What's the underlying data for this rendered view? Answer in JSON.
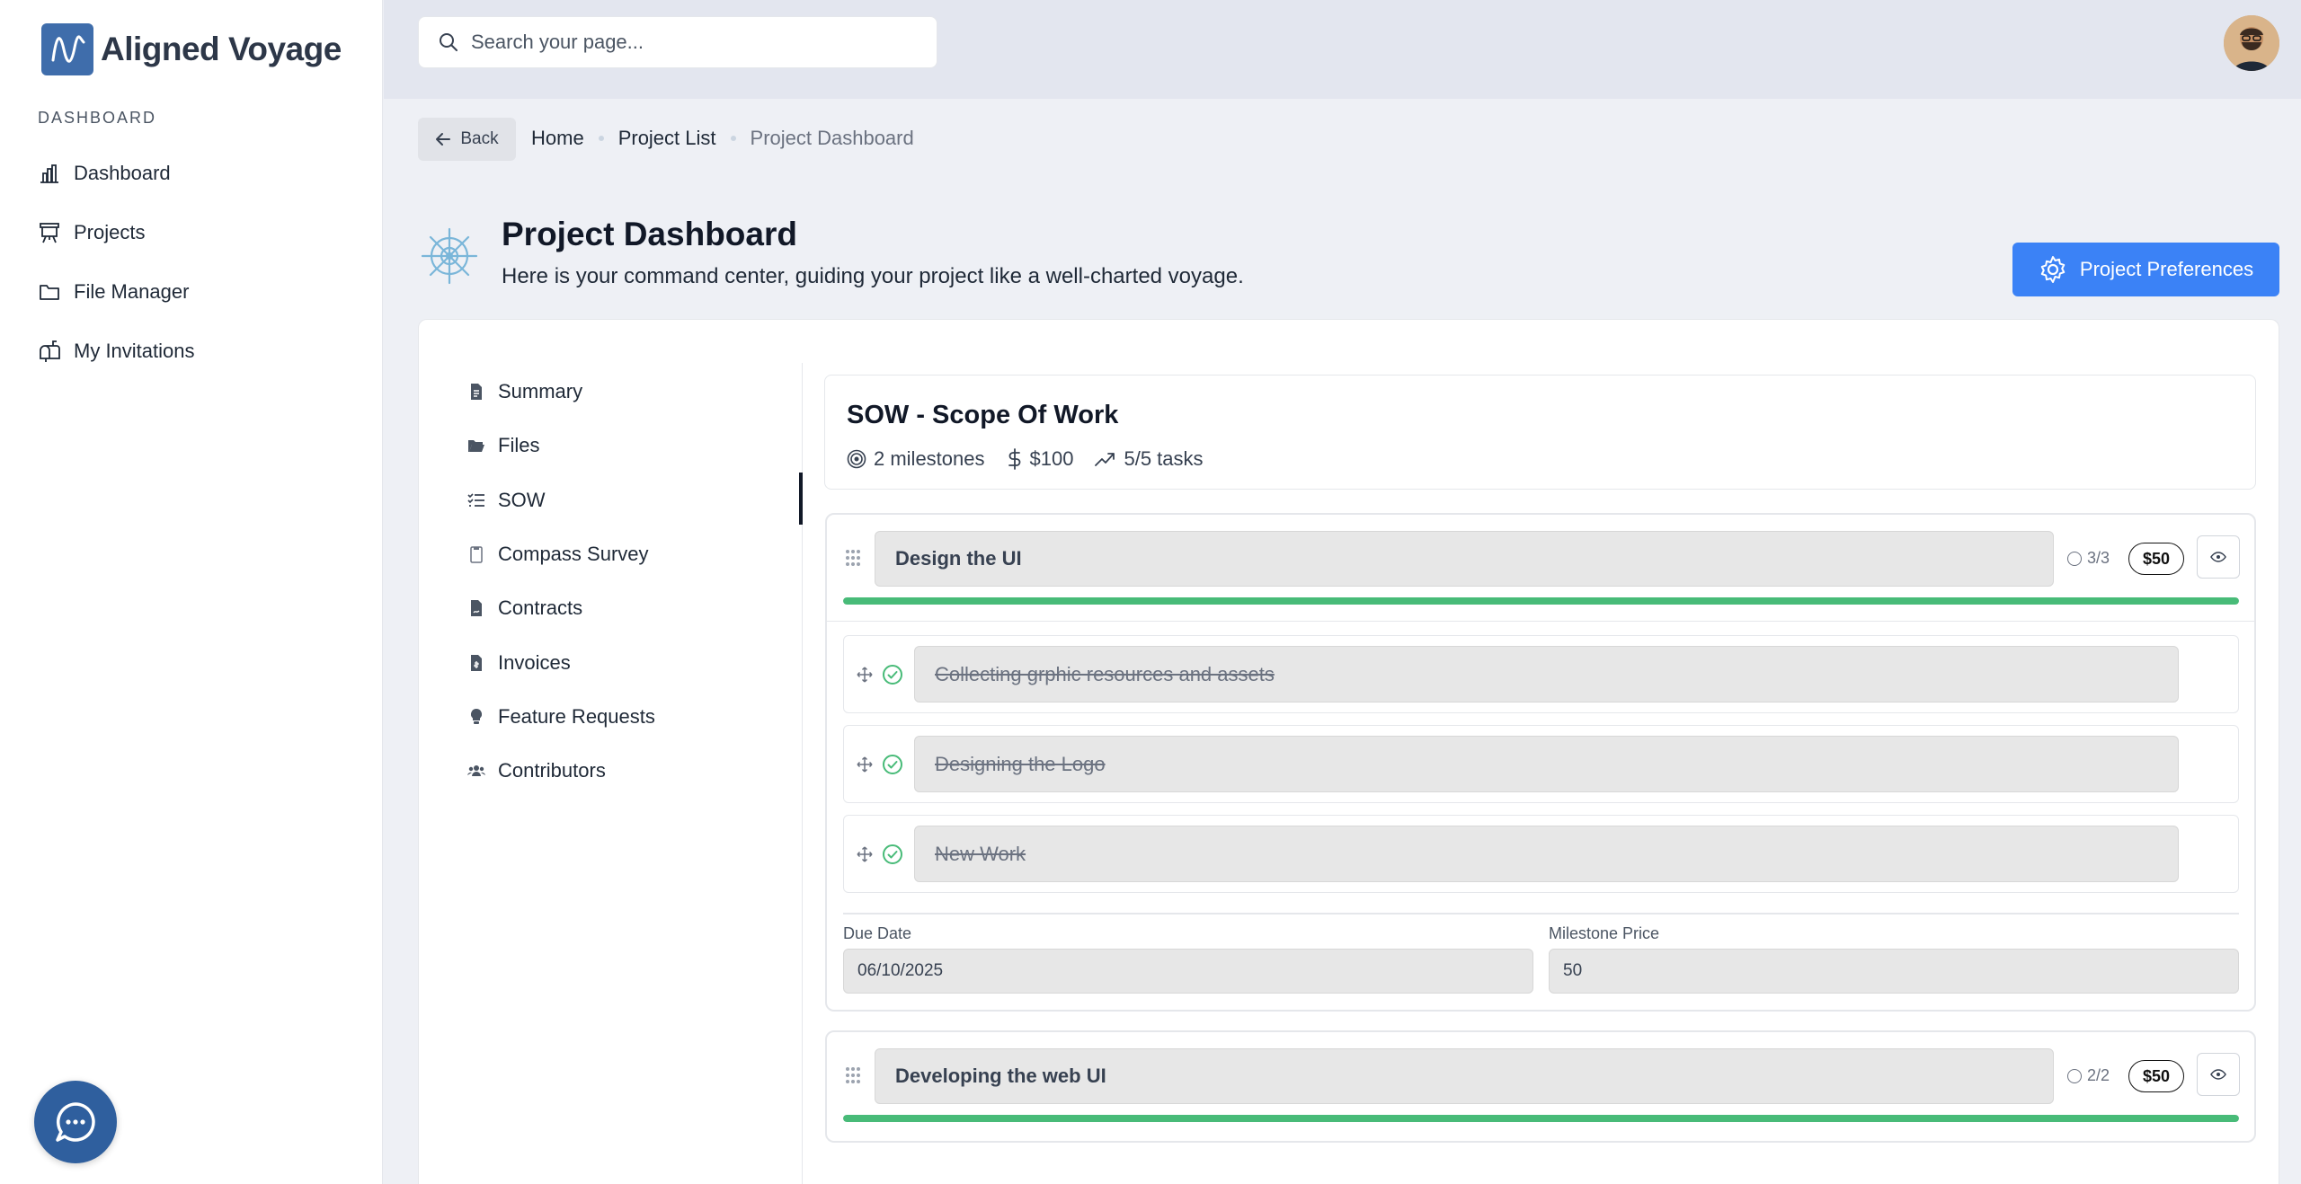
{
  "app": {
    "name": "Aligned Voyage"
  },
  "sidebar": {
    "section_label": "DASHBOARD",
    "items": [
      {
        "label": "Dashboard",
        "icon": "bar-chart-icon"
      },
      {
        "label": "Projects",
        "icon": "easel-icon"
      },
      {
        "label": "File Manager",
        "icon": "folder-icon"
      },
      {
        "label": "My Invitations",
        "icon": "mailbox-icon"
      }
    ]
  },
  "search": {
    "placeholder": "Search your page..."
  },
  "breadcrumb": {
    "back_label": "Back",
    "items": [
      "Home",
      "Project List",
      "Project Dashboard"
    ]
  },
  "header": {
    "title": "Project Dashboard",
    "subtitle": "Here is your command center, guiding your project like a well-charted voyage.",
    "preferences_label": "Project Preferences"
  },
  "tabs": [
    {
      "label": "Summary",
      "icon": "file-text-icon"
    },
    {
      "label": "Files",
      "icon": "folder-open-icon"
    },
    {
      "label": "SOW",
      "icon": "list-check-icon",
      "active": true
    },
    {
      "label": "Compass Survey",
      "icon": "clipboard-icon"
    },
    {
      "label": "Contracts",
      "icon": "file-contract-icon"
    },
    {
      "label": "Invoices",
      "icon": "file-invoice-icon"
    },
    {
      "label": "Feature Requests",
      "icon": "lightbulb-icon"
    },
    {
      "label": "Contributors",
      "icon": "users-icon"
    }
  ],
  "sow": {
    "title": "SOW - Scope Of Work",
    "milestones_text": "2 milestones",
    "amount_text": "$100",
    "tasks_text": "5/5 tasks"
  },
  "milestones": [
    {
      "name": "Design the UI",
      "count": "3/3",
      "price": "$50",
      "progress": 1.0,
      "tasks": [
        "Collecting grphic resources and assets",
        "Designing the Logo",
        "New Work"
      ],
      "due_date_label": "Due Date",
      "due_date": "06/10/2025",
      "price_label": "Milestone Price",
      "price_value": "50"
    },
    {
      "name": "Developing the web UI",
      "count": "2/2",
      "price": "$50",
      "progress": 1.0
    }
  ],
  "colors": {
    "accent": "#3b82f6",
    "brand": "#3f6dab",
    "progress": "#48bb78"
  }
}
